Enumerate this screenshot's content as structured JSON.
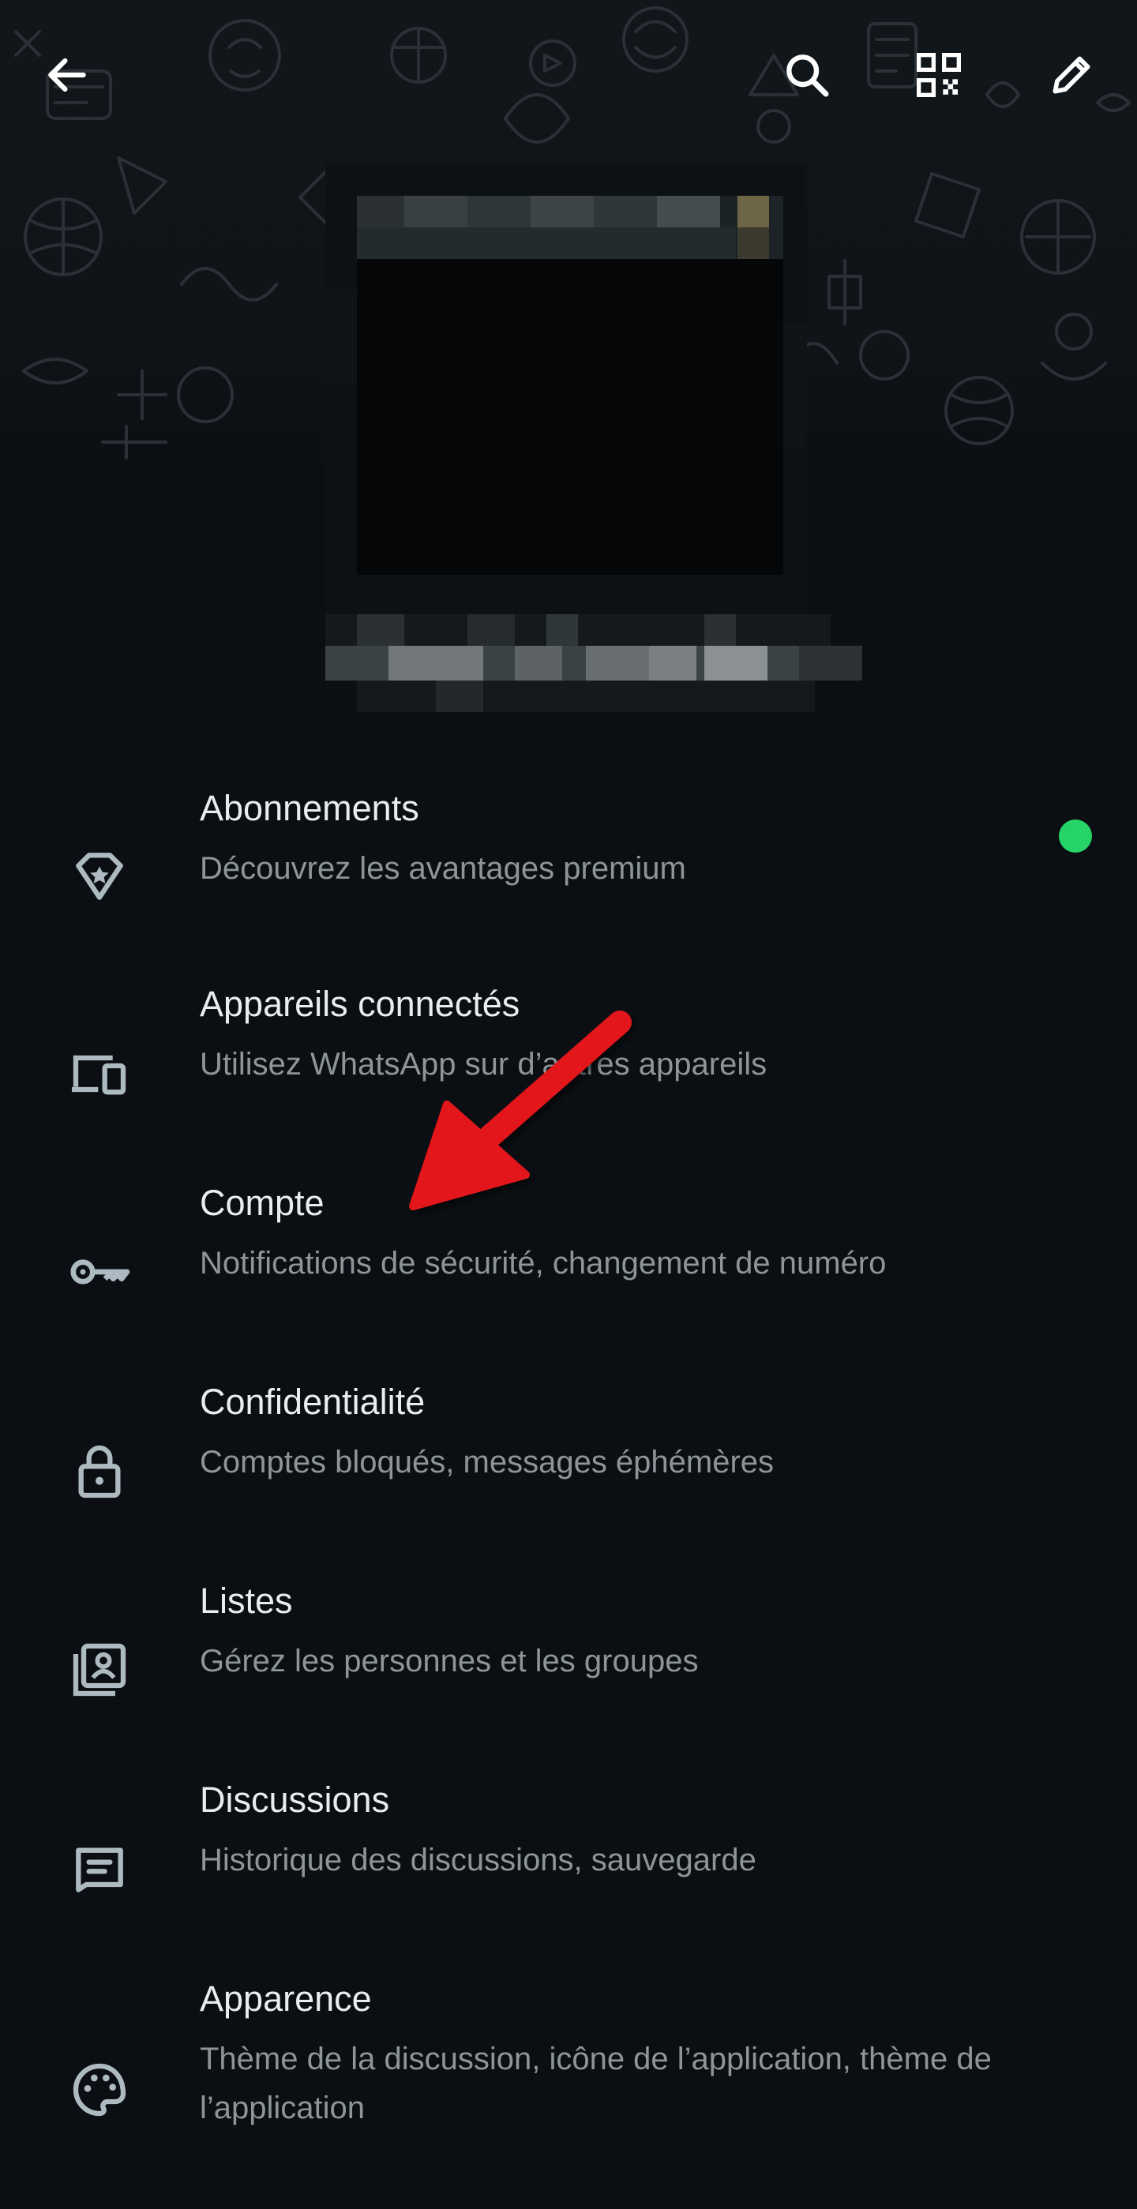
{
  "header": {
    "back_icon": "arrow-left-icon",
    "search_icon": "search-icon",
    "qr_icon": "qr-code-icon",
    "edit_icon": "pencil-icon"
  },
  "profile": {
    "photo": "pixelated-profile-photo",
    "name": "pixelated-profile-name"
  },
  "menu": {
    "items": [
      {
        "title": "Abonnements",
        "subtitle": "Découvrez les avantages premium",
        "icon": "premium-badge-icon"
      },
      {
        "title": "Appareils connectés",
        "subtitle": "Utilisez WhatsApp sur d’autres appareils",
        "icon": "devices-icon"
      },
      {
        "title": "Compte",
        "subtitle": "Notifications de sécurité, changement de numéro",
        "icon": "key-icon"
      },
      {
        "title": "Confidentialité",
        "subtitle": "Comptes bloqués, messages éphémères",
        "icon": "lock-icon"
      },
      {
        "title": "Listes",
        "subtitle": "Gérez les personnes et les groupes",
        "icon": "contact-list-icon"
      },
      {
        "title": "Discussions",
        "subtitle": "Historique des discussions, sauvegarde",
        "icon": "chat-icon"
      },
      {
        "title": "Apparence",
        "subtitle": "Thème de la discussion, icône de l’application, thème de l’application",
        "icon": "palette-icon"
      }
    ]
  },
  "colors": {
    "background": "#0b0f13",
    "title": "#e9edef",
    "subtitle": "#8d9599",
    "icon": "#aebac1",
    "status_dot": "#25d366",
    "annotation_arrow": "#e3161b"
  },
  "annotation": {
    "icon": "red-arrow-icon"
  }
}
